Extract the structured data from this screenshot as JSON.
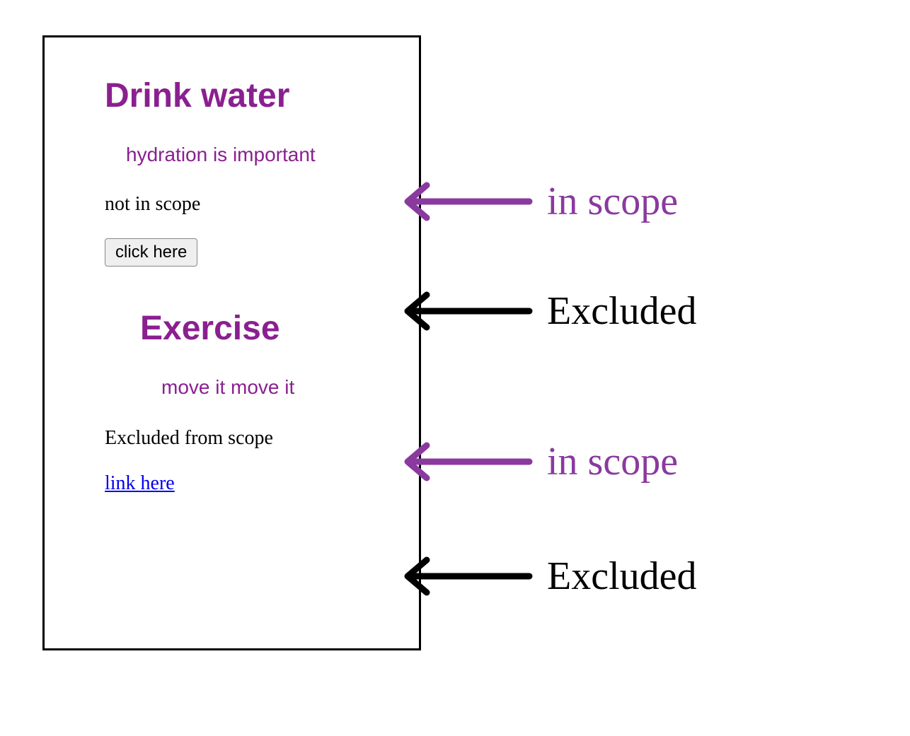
{
  "box": {
    "section1": {
      "heading": "Drink water",
      "subtext": "hydration is important",
      "plain": "not in scope",
      "button_label": "click here"
    },
    "section2": {
      "heading": "Exercise",
      "subtext": "move it move it",
      "plain": "Excluded from scope",
      "link_label": "link here"
    }
  },
  "annotations": {
    "in_scope_1": "in scope",
    "excluded_1": "Excluded",
    "in_scope_2": "in scope",
    "excluded_2": "Excluded"
  }
}
